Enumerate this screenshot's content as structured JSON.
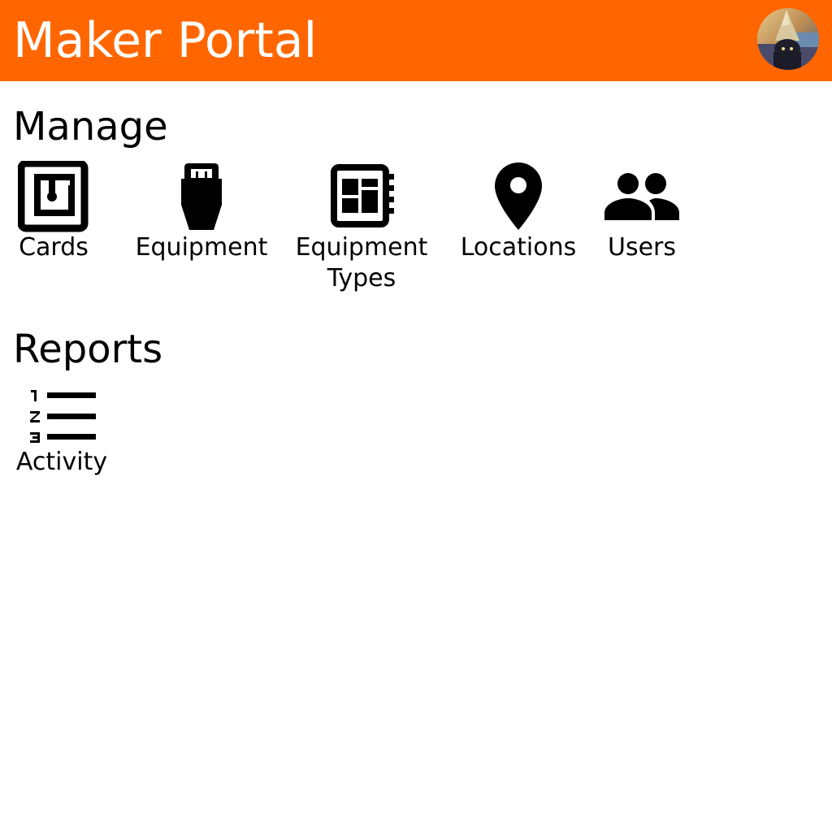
{
  "header": {
    "title": "Maker Portal",
    "brand_color": "#ff6600",
    "avatar_icon": "user-avatar"
  },
  "manage": {
    "title": "Manage",
    "items": [
      {
        "label": "Cards",
        "icon": "nfc-icon"
      },
      {
        "label": "Equipment",
        "icon": "ethernet-plug-icon"
      },
      {
        "label": "Equipment Types",
        "icon": "dashboard-chip-icon"
      },
      {
        "label": "Locations",
        "icon": "location-pin-icon"
      },
      {
        "label": "Users",
        "icon": "people-icon"
      }
    ]
  },
  "reports": {
    "title": "Reports",
    "items": [
      {
        "label": "Activity",
        "icon": "numbered-list-icon"
      }
    ]
  }
}
